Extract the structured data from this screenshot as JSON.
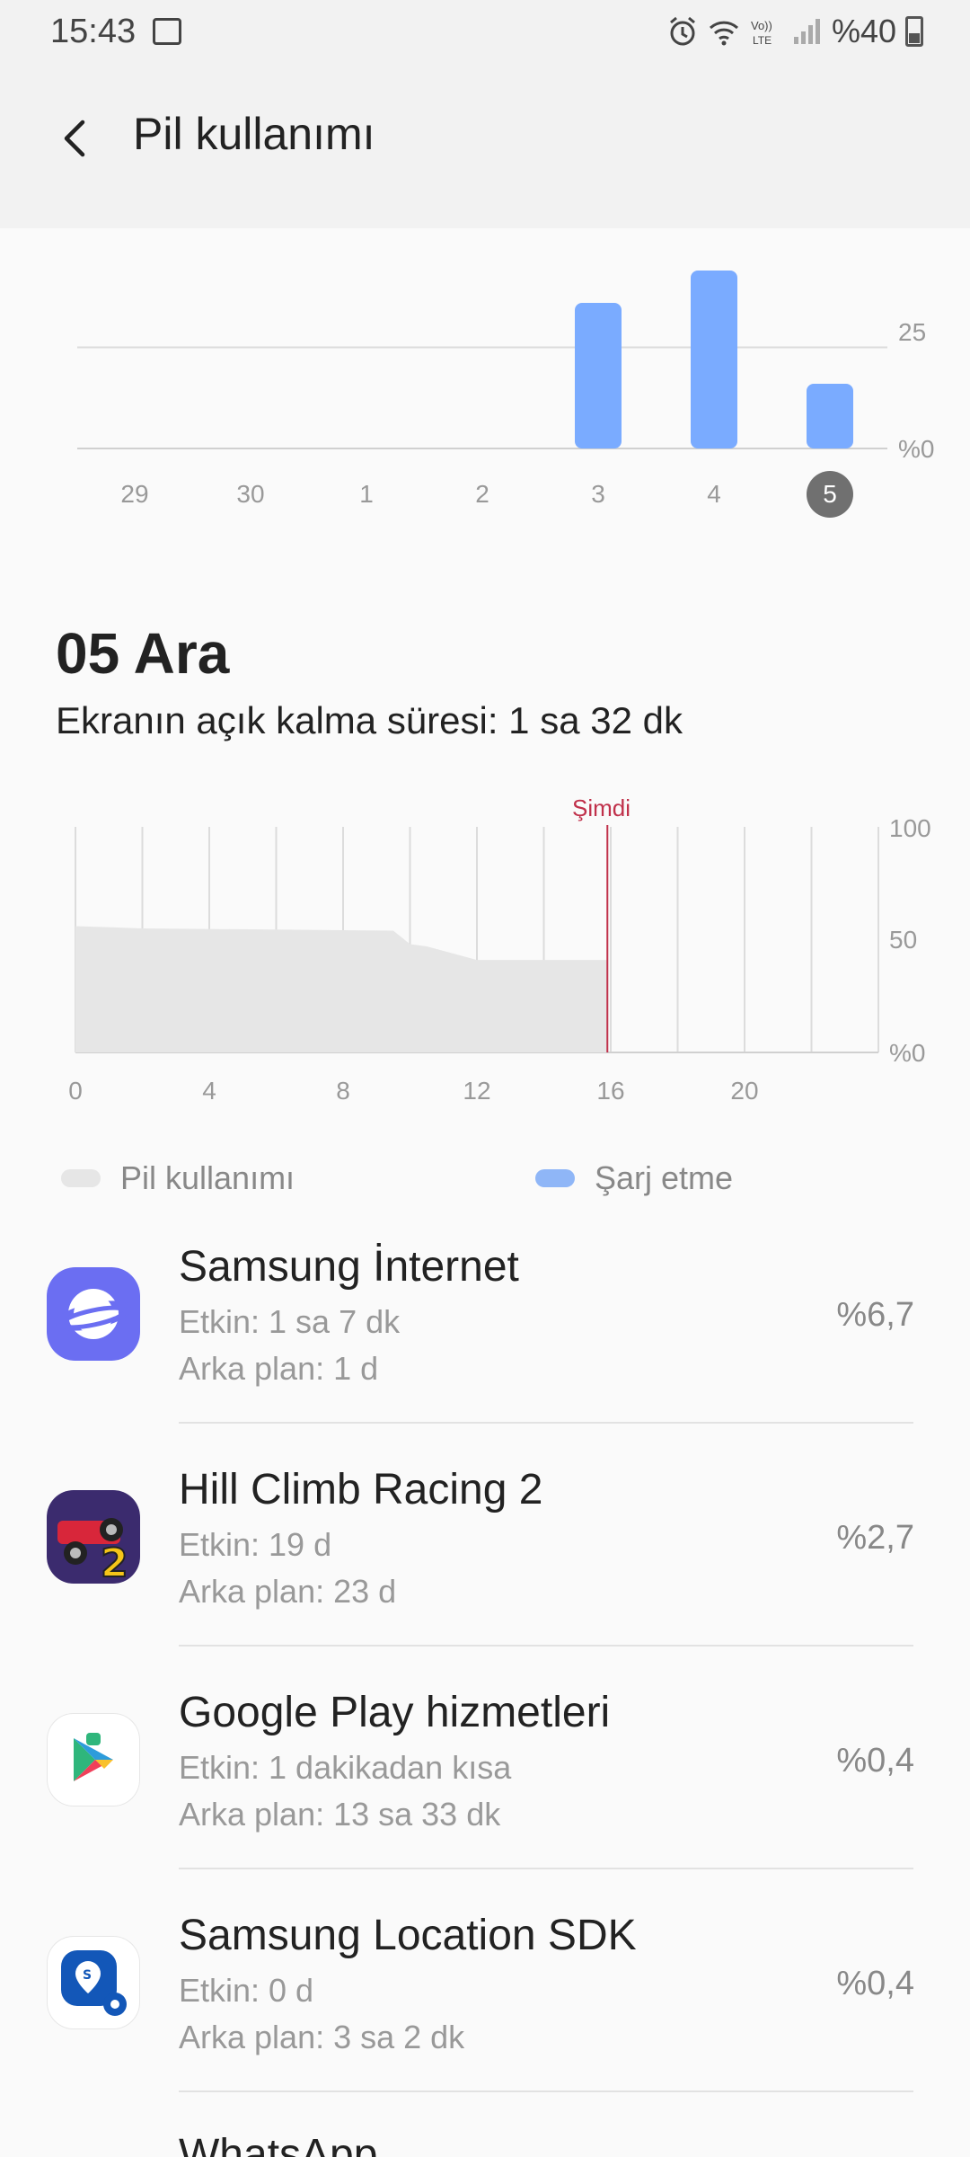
{
  "status_bar": {
    "time": "15:43",
    "battery": "%40"
  },
  "header": {
    "title": "Pil kullanımı"
  },
  "weekly_chart": {
    "days": [
      "29",
      "30",
      "1",
      "2",
      "3",
      "4",
      "5"
    ],
    "selected_day": "5",
    "y_labels": [
      "25",
      "%0"
    ]
  },
  "selected": {
    "date": "05 Ara",
    "screen_time": "Ekranın açık kalma süresi: 1 sa 32 dk"
  },
  "day_chart": {
    "now_label": "Şimdi",
    "x_labels": [
      "0",
      "4",
      "8",
      "12",
      "16",
      "20"
    ],
    "y_labels": [
      "100",
      "50",
      "%0"
    ]
  },
  "legend": {
    "usage": "Pil kullanımı",
    "charging": "Şarj etme"
  },
  "apps": [
    {
      "name": "Samsung İnternet",
      "active": "Etkin: 1 sa 7 dk",
      "background": "Arka plan: 1 d",
      "percent": "%6,7"
    },
    {
      "name": "Hill Climb Racing 2",
      "active": "Etkin: 19 d",
      "background": "Arka plan: 23 d",
      "percent": "%2,7"
    },
    {
      "name": "Google Play hizmetleri",
      "active": "Etkin: 1 dakikadan kısa",
      "background": "Arka plan: 13 sa 33 dk",
      "percent": "%0,4"
    },
    {
      "name": "Samsung Location SDK",
      "active": "Etkin: 0 d",
      "background": "Arka plan: 3 sa 2 dk",
      "percent": "%0,4"
    },
    {
      "name": "WhatsApp"
    }
  ],
  "chart_data": [
    {
      "type": "bar",
      "categories": [
        "29",
        "30",
        "1",
        "2",
        "3",
        "4",
        "5"
      ],
      "values": [
        0,
        0,
        0,
        0,
        36,
        44,
        16
      ],
      "ylim": [
        0,
        50
      ],
      "colors": {
        "bar": "#7aabff"
      }
    },
    {
      "type": "area",
      "x": [
        0,
        2,
        9.5,
        10,
        10.5,
        12,
        15.9
      ],
      "y": [
        56,
        55,
        54,
        48,
        47,
        41,
        41
      ],
      "xlim": [
        0,
        24
      ],
      "ylim": [
        0,
        100
      ],
      "now": 15.9,
      "colors": {
        "area": "#e6e6e6",
        "now_line": "#c0304a"
      }
    }
  ]
}
